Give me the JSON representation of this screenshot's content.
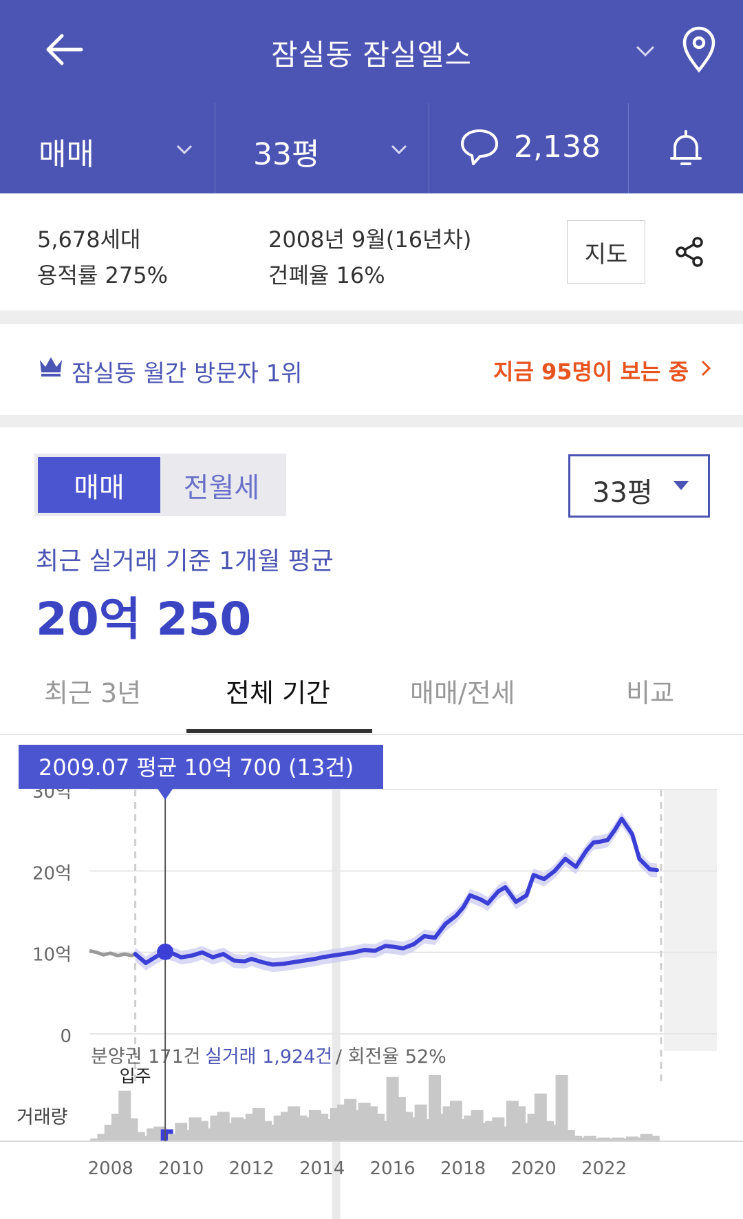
{
  "header": {
    "title": "잠실동 잠실엘스",
    "back_icon": "arrow-left-icon",
    "dropdown_icon": "chevron-down-icon",
    "location_icon": "map-pin-icon"
  },
  "subbar": {
    "trade_type": "매매",
    "size": "33평",
    "comment_count": "2,138",
    "comment_icon": "speech-bubble-icon",
    "bell_icon": "bell-icon"
  },
  "info": {
    "households": "5,678세대",
    "far": "용적률 275%",
    "built": "2008년 9월(16년차)",
    "bcr": "건폐율 16%",
    "map_button": "지도",
    "share_icon": "share-icon"
  },
  "visitor": {
    "rank_text": "잠실동 월간 방문자 1위",
    "live_text": "지금 95명이 보는 중",
    "crown_icon": "crown-icon",
    "accent": "#e8541f"
  },
  "toggle": {
    "sale": "매매",
    "rent": "전월세"
  },
  "size_select": "33평",
  "price": {
    "caption": "최근 실거래 기준 1개월 평균",
    "value": "20억 250"
  },
  "tabs": [
    "최근 3년",
    "전체 기간",
    "매매/전세",
    "비교"
  ],
  "active_tab": 1,
  "colors": {
    "brand": "#4c55b3",
    "line": "#3b3fd6",
    "band": "#c9c9f2",
    "presale": "#999999",
    "volume": "#c8c8c8"
  },
  "chart_data": {
    "type": "line",
    "y_tick_labels": [
      "0",
      "10억",
      "20억",
      "30억"
    ],
    "y_ticks": [
      0,
      10,
      20,
      30
    ],
    "ylim": [
      0,
      30
    ],
    "x_ticks": [
      2008,
      2010,
      2012,
      2014,
      2016,
      2018,
      2020,
      2022
    ],
    "x_tick_labels": [
      "2008",
      "2010",
      "2012",
      "2014",
      "2016",
      "2018",
      "2020",
      "2022"
    ],
    "xlim": [
      2007.4,
      2025.2
    ],
    "move_in_label": "입주",
    "move_in": 2008.7,
    "tooltip": "2009.07 평균 10억 700 (13건)",
    "tooltip_x": 2009.55,
    "tooltip_y": 10.07,
    "summary_presale": "분양권 171건",
    "summary_trades": "실거래 1,924건",
    "summary_turnover": "/ 회전율 52%",
    "volume_label": "거래량",
    "presale_series": {
      "name": "분양권",
      "x": [
        2007.4,
        2007.6,
        2007.8,
        2008.0,
        2008.2,
        2008.4,
        2008.6,
        2008.7
      ],
      "y": [
        10.2,
        10.0,
        9.7,
        9.9,
        9.6,
        9.8,
        9.6,
        9.8
      ]
    },
    "series": [
      {
        "name": "실거래",
        "x": [
          2008.7,
          2009.0,
          2009.3,
          2009.55,
          2009.8,
          2010.0,
          2010.3,
          2010.6,
          2010.9,
          2011.2,
          2011.5,
          2011.8,
          2012.0,
          2012.3,
          2012.6,
          2012.9,
          2013.2,
          2013.5,
          2013.8,
          2014.0,
          2014.3,
          2014.6,
          2014.9,
          2015.2,
          2015.5,
          2015.8,
          2016.0,
          2016.3,
          2016.6,
          2016.9,
          2017.2,
          2017.5,
          2017.8,
          2018.0,
          2018.2,
          2018.5,
          2018.7,
          2019.0,
          2019.2,
          2019.5,
          2019.8,
          2020.0,
          2020.3,
          2020.6,
          2020.9,
          2021.2,
          2021.5,
          2021.7,
          2021.9,
          2022.1,
          2022.3,
          2022.5,
          2022.8,
          2023.0,
          2023.3,
          2023.5
        ],
        "y": [
          9.8,
          8.7,
          9.5,
          10.1,
          9.8,
          9.4,
          9.6,
          10.0,
          9.4,
          9.8,
          9.0,
          8.9,
          9.2,
          8.8,
          8.5,
          8.6,
          8.8,
          9.0,
          9.2,
          9.4,
          9.6,
          9.8,
          10.0,
          10.3,
          10.2,
          10.8,
          10.7,
          10.5,
          11.0,
          12.0,
          11.8,
          13.5,
          14.5,
          15.5,
          17.0,
          16.5,
          16.0,
          17.5,
          18.0,
          16.2,
          17.0,
          19.5,
          19.0,
          20.0,
          21.5,
          20.5,
          22.5,
          23.5,
          23.6,
          23.8,
          25.0,
          26.4,
          24.5,
          21.5,
          20.2,
          20.1
        ]
      }
    ],
    "volume": {
      "x": [
        2007.6,
        2007.8,
        2008.0,
        2008.2,
        2008.4,
        2008.6,
        2008.8,
        2009.0,
        2009.2,
        2009.4,
        2009.6,
        2009.8,
        2010.0,
        2010.2,
        2010.4,
        2010.6,
        2010.8,
        2011.0,
        2011.2,
        2011.4,
        2011.6,
        2011.8,
        2012.0,
        2012.2,
        2012.4,
        2012.6,
        2012.8,
        2013.0,
        2013.2,
        2013.4,
        2013.6,
        2013.8,
        2014.0,
        2014.2,
        2014.4,
        2014.6,
        2014.8,
        2015.0,
        2015.2,
        2015.4,
        2015.6,
        2015.8,
        2016.0,
        2016.2,
        2016.4,
        2016.6,
        2016.8,
        2017.0,
        2017.2,
        2017.4,
        2017.6,
        2017.8,
        2018.0,
        2018.2,
        2018.4,
        2018.6,
        2018.8,
        2019.0,
        2019.2,
        2019.4,
        2019.6,
        2019.8,
        2020.0,
        2020.2,
        2020.4,
        2020.6,
        2020.8,
        2021.0,
        2021.2,
        2021.4,
        2021.6,
        2021.8,
        2022.0,
        2022.2,
        2022.4,
        2022.6,
        2022.8,
        2023.0,
        2023.2,
        2023.4
      ],
      "y": [
        3,
        8,
        18,
        30,
        55,
        25,
        10,
        6,
        14,
        16,
        13,
        8,
        20,
        12,
        26,
        22,
        14,
        28,
        32,
        20,
        26,
        24,
        30,
        36,
        22,
        18,
        28,
        32,
        38,
        28,
        26,
        34,
        30,
        24,
        36,
        40,
        46,
        34,
        42,
        38,
        30,
        22,
        70,
        48,
        32,
        26,
        40,
        24,
        72,
        30,
        38,
        44,
        24,
        28,
        34,
        20,
        22,
        26,
        16,
        44,
        38,
        20,
        30,
        52,
        22,
        18,
        72,
        12,
        6,
        4,
        6,
        3,
        4,
        3,
        4,
        3,
        5,
        4,
        8,
        6
      ]
    }
  }
}
